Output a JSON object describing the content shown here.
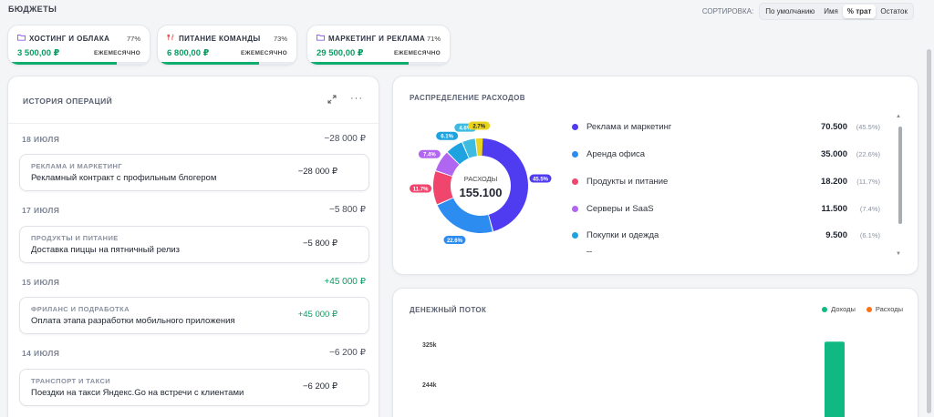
{
  "header": {
    "title": "Бюджеты",
    "sort_label": "СОРТИРОВКА:",
    "sort_options": [
      {
        "label": "По умолчанию",
        "active": false
      },
      {
        "label": "Имя",
        "active": false
      },
      {
        "label": "% трат",
        "active": true
      },
      {
        "label": "Остаток",
        "active": false
      }
    ]
  },
  "budgets": [
    {
      "name": "Хостинг и облака",
      "percent": "77%",
      "percent_value": 0.77,
      "amount": "3 500,00 ₽",
      "period": "ЕЖЕМЕСЯЧНО",
      "icon": "folder-icon",
      "icon_color": "#8b5cf6"
    },
    {
      "name": "Питание команды",
      "percent": "73%",
      "percent_value": 0.73,
      "amount": "6 800,00 ₽",
      "period": "ЕЖЕМЕСЯЧНО",
      "icon": "fork-knife-icon",
      "icon_color": "#e5484d"
    },
    {
      "name": "Маркетинг и реклама",
      "percent": "71%",
      "percent_value": 0.71,
      "amount": "29 500,00 ₽",
      "period": "ЕЖЕМЕСЯЧНО",
      "icon": "folder-icon",
      "icon_color": "#8b5cf6"
    }
  ],
  "history": {
    "title": "История операций",
    "groups": [
      {
        "date": "18 июля",
        "total": "−28 000 ₽",
        "positive": false,
        "tx": [
          {
            "category": "Реклама и маркетинг",
            "description": "Рекламный контракт с профильным блогером",
            "amount": "−28 000 ₽",
            "positive": false
          }
        ]
      },
      {
        "date": "17 июля",
        "total": "−5 800 ₽",
        "positive": false,
        "tx": [
          {
            "category": "Продукты и питание",
            "description": "Доставка пиццы на пятничный релиз",
            "amount": "−5 800 ₽",
            "positive": false
          }
        ]
      },
      {
        "date": "15 июля",
        "total": "+45 000 ₽",
        "positive": true,
        "tx": [
          {
            "category": "Фриланс и подработка",
            "description": "Оплата этапа разработки мобильного приложения",
            "amount": "+45 000 ₽",
            "positive": true
          }
        ]
      },
      {
        "date": "14 июля",
        "total": "−6 200 ₽",
        "positive": false,
        "tx": [
          {
            "category": "Транспорт и такси",
            "description": "Поездки на такси Яндекс.Go на встречи с клиентами",
            "amount": "−6 200 ₽",
            "positive": false
          }
        ]
      }
    ]
  },
  "distribution": {
    "title": "Распределение расходов",
    "center_label": "РАСХОДЫ",
    "center_value": "155.100",
    "items": [
      {
        "name": "Реклама и маркетинг",
        "value": "70.500",
        "pct": "(45.5%)",
        "chip": "45.5%",
        "fraction": 0.455,
        "color": "#4f3cf0"
      },
      {
        "name": "Аренда офиса",
        "value": "35.000",
        "pct": "(22.6%)",
        "chip": "22.6%",
        "fraction": 0.226,
        "color": "#2d8cf0"
      },
      {
        "name": "Продукты и питание",
        "value": "18.200",
        "pct": "(11.7%)",
        "chip": "11.7%",
        "fraction": 0.117,
        "color": "#f0466e"
      },
      {
        "name": "Серверы и SaaS",
        "value": "11.500",
        "pct": "(7.4%)",
        "chip": "7.4%",
        "fraction": 0.074,
        "color": "#b066f0"
      },
      {
        "name": "Покупки и одежда",
        "value": "9.500",
        "pct": "(6.1%)",
        "chip": "6.1%",
        "fraction": 0.061,
        "color": "#1fa3e0"
      },
      {
        "name": "",
        "value": "",
        "pct": "",
        "chip": "4.6%",
        "fraction": 0.046,
        "color": "#3dbbe0"
      },
      {
        "name": "",
        "value": "",
        "pct": "",
        "chip": "2.7%",
        "fraction": 0.027,
        "color": "#e8d320"
      }
    ]
  },
  "cashflow": {
    "title": "Денежный поток",
    "legend": [
      {
        "name": "Доходы",
        "color": "#10b981"
      },
      {
        "name": "Расходы",
        "color": "#f97316"
      }
    ],
    "chart_data": {
      "type": "bar",
      "ticks": [
        "325k",
        "244k"
      ],
      "tick_values": [
        325000,
        244000
      ],
      "series": [
        {
          "name": "Доходы",
          "values": [
            330000
          ]
        }
      ]
    }
  }
}
